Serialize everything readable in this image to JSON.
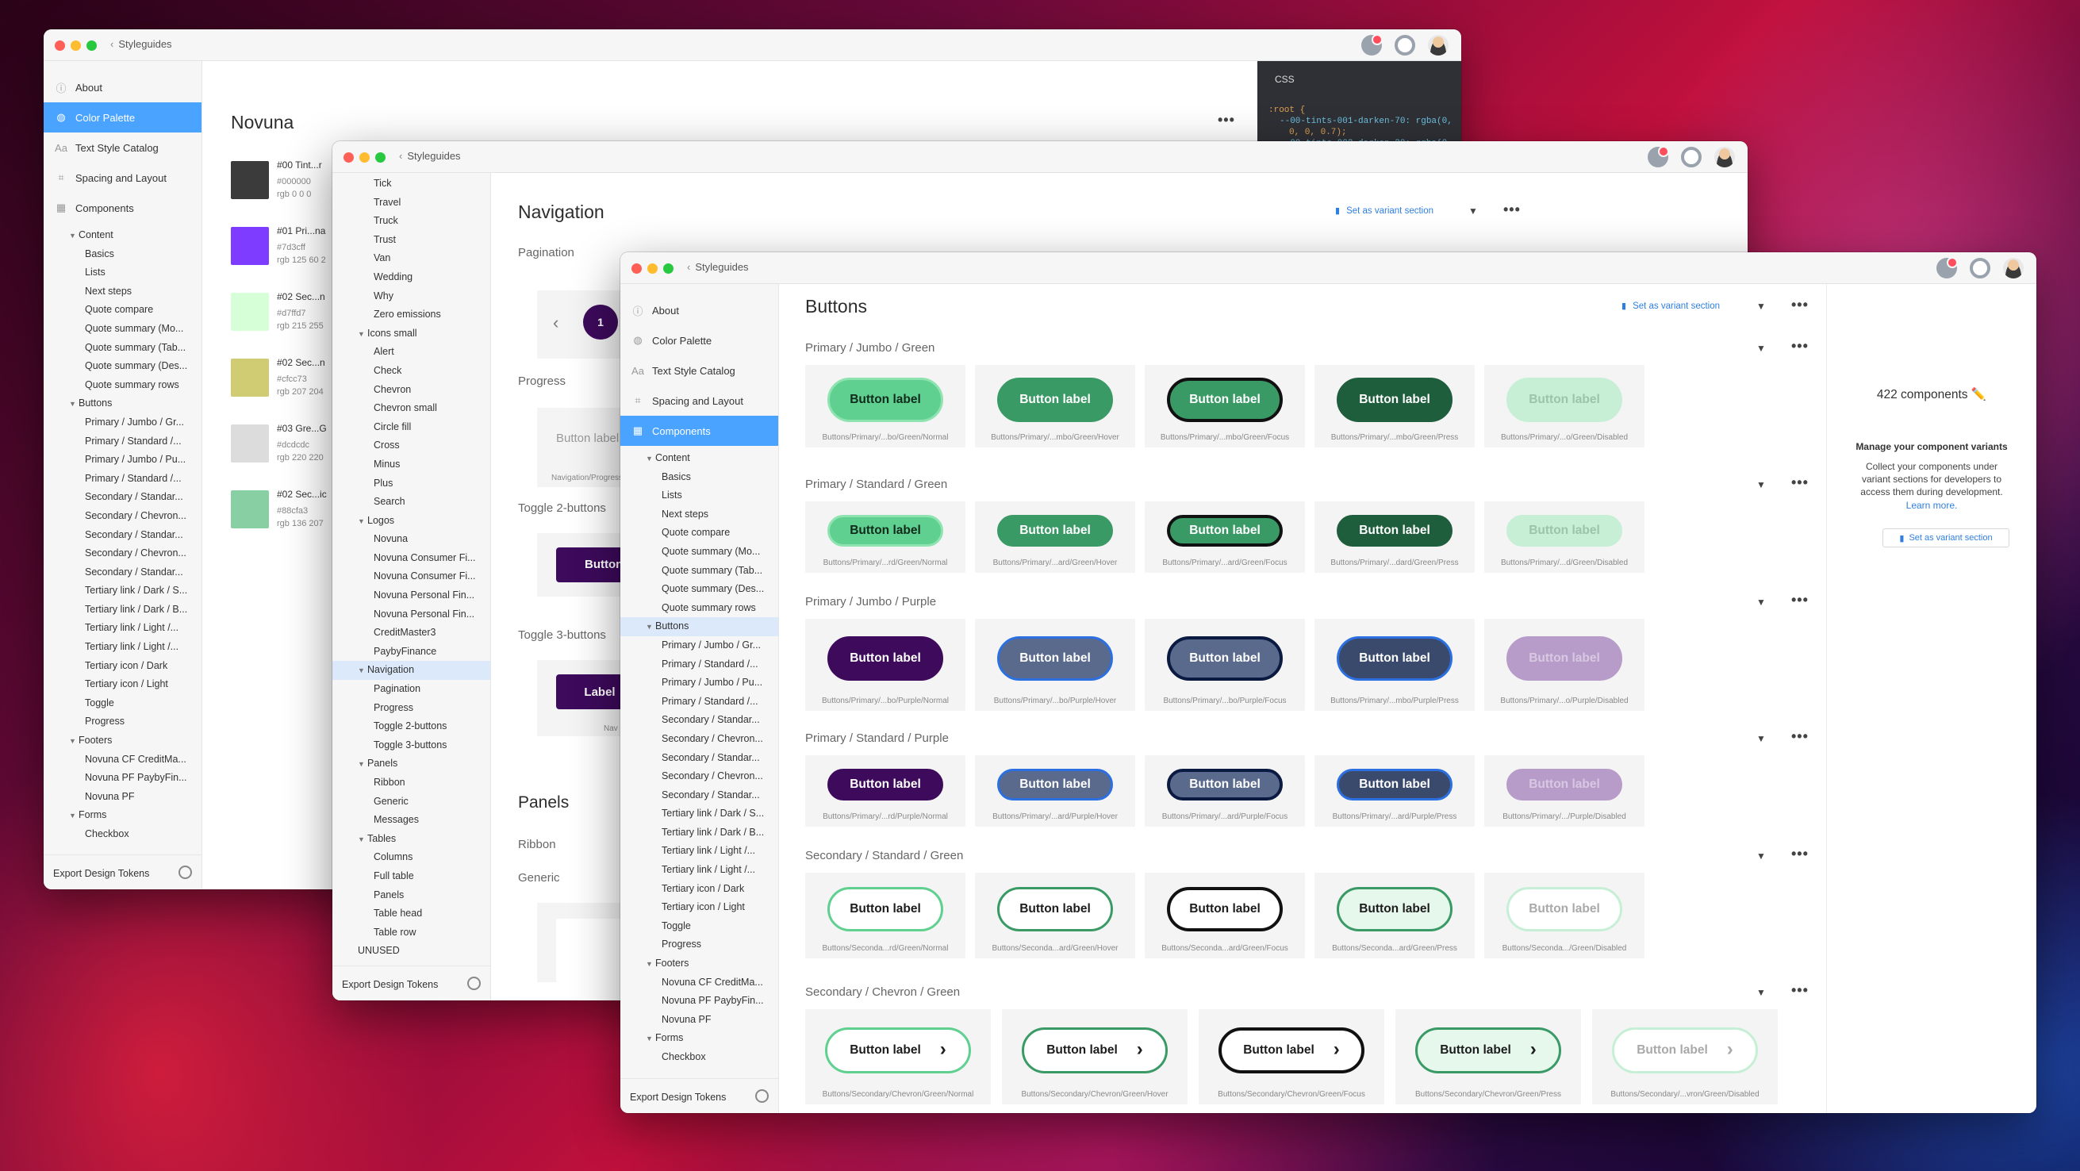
{
  "app_crumb": "Styleguides",
  "win1": {
    "title": "Novuna",
    "nav": [
      "About",
      "Color Palette",
      "Text Style Catalog",
      "Spacing and Layout",
      "Components"
    ],
    "tree": [
      {
        "t": "Content",
        "lvl": 1,
        "caret": true
      },
      {
        "t": "Basics",
        "lvl": 2
      },
      {
        "t": "Lists",
        "lvl": 2
      },
      {
        "t": "Next steps",
        "lvl": 2
      },
      {
        "t": "Quote compare",
        "lvl": 2
      },
      {
        "t": "Quote summary (Mo...",
        "lvl": 2
      },
      {
        "t": "Quote summary (Tab...",
        "lvl": 2
      },
      {
        "t": "Quote summary (Des...",
        "lvl": 2
      },
      {
        "t": "Quote summary rows",
        "lvl": 2
      },
      {
        "t": "Buttons",
        "lvl": 1,
        "caret": true
      },
      {
        "t": "Primary / Jumbo / Gr...",
        "lvl": 2
      },
      {
        "t": "Primary / Standard /...",
        "lvl": 2
      },
      {
        "t": "Primary / Jumbo / Pu...",
        "lvl": 2
      },
      {
        "t": "Primary / Standard /...",
        "lvl": 2
      },
      {
        "t": "Secondary / Standar...",
        "lvl": 2
      },
      {
        "t": "Secondary / Chevron...",
        "lvl": 2
      },
      {
        "t": "Secondary / Standar...",
        "lvl": 2
      },
      {
        "t": "Secondary / Chevron...",
        "lvl": 2
      },
      {
        "t": "Secondary / Standar...",
        "lvl": 2
      },
      {
        "t": "Tertiary link / Dark / S...",
        "lvl": 2
      },
      {
        "t": "Tertiary link / Dark / B...",
        "lvl": 2
      },
      {
        "t": "Tertiary link / Light /...",
        "lvl": 2
      },
      {
        "t": "Tertiary link / Light /...",
        "lvl": 2
      },
      {
        "t": "Tertiary icon / Dark",
        "lvl": 2
      },
      {
        "t": "Tertiary icon / Light",
        "lvl": 2
      },
      {
        "t": "Toggle",
        "lvl": 2
      },
      {
        "t": "Progress",
        "lvl": 2
      },
      {
        "t": "Footers",
        "lvl": 1,
        "caret": true
      },
      {
        "t": "Novuna CF CreditMa...",
        "lvl": 2
      },
      {
        "t": "Novuna PF PaybyFin...",
        "lvl": 2
      },
      {
        "t": "Novuna PF",
        "lvl": 2
      },
      {
        "t": "Forms",
        "lvl": 1,
        "caret": true
      },
      {
        "t": "Checkbox",
        "lvl": 2
      }
    ],
    "footer": "Export Design Tokens",
    "swatches": [
      {
        "name": "#00 Tint...r",
        "hex": "#000000",
        "rgb": "rgb 0 0 0",
        "color": "#3b3b3b"
      },
      {
        "name": "#01 Pri...na",
        "hex": "#7d3cff",
        "rgb": "rgb 125 60 2",
        "color": "#7d3cff"
      },
      {
        "name": "#02 Sec...n",
        "hex": "#d7ffd7",
        "rgb": "rgb 215 255",
        "color": "#d7ffd7"
      },
      {
        "name": "#02 Sec...n",
        "hex": "#cfcc73",
        "rgb": "rgb 207 204",
        "color": "#cfcc73"
      },
      {
        "name": "#03 Gre...G",
        "hex": "#dcdcdc",
        "rgb": "rgb 220 220",
        "color": "#dcdcdc"
      },
      {
        "name": "#02 Sec...ic",
        "hex": "#88cfa3",
        "rgb": "rgb 136 207",
        "color": "#88cfa3"
      }
    ],
    "css": {
      "tab": "CSS",
      "l1": ":root {",
      "l2": "--00-tints-001-darken-70: rgba(0,",
      "l3": "0, 0, 0.7);",
      "l4": "--00-tints-002-darken-30: rgba(0,"
    }
  },
  "win2": {
    "title": "Navigation",
    "set_variant": "Set as variant section",
    "tree": [
      {
        "t": "Tick",
        "lvl": 2
      },
      {
        "t": "Travel",
        "lvl": 2
      },
      {
        "t": "Truck",
        "lvl": 2
      },
      {
        "t": "Trust",
        "lvl": 2
      },
      {
        "t": "Van",
        "lvl": 2
      },
      {
        "t": "Wedding",
        "lvl": 2
      },
      {
        "t": "Why",
        "lvl": 2
      },
      {
        "t": "Zero emissions",
        "lvl": 2
      },
      {
        "t": "Icons small",
        "lvl": 1,
        "caret": true
      },
      {
        "t": "Alert",
        "lvl": 2
      },
      {
        "t": "Check",
        "lvl": 2
      },
      {
        "t": "Chevron",
        "lvl": 2
      },
      {
        "t": "Chevron small",
        "lvl": 2
      },
      {
        "t": "Circle fill",
        "lvl": 2
      },
      {
        "t": "Cross",
        "lvl": 2
      },
      {
        "t": "Minus",
        "lvl": 2
      },
      {
        "t": "Plus",
        "lvl": 2
      },
      {
        "t": "Search",
        "lvl": 2
      },
      {
        "t": "Logos",
        "lvl": 1,
        "caret": true
      },
      {
        "t": "Novuna",
        "lvl": 2
      },
      {
        "t": "Novuna Consumer Fi...",
        "lvl": 2
      },
      {
        "t": "Novuna Consumer Fi...",
        "lvl": 2
      },
      {
        "t": "Novuna Personal Fin...",
        "lvl": 2
      },
      {
        "t": "Novuna Personal Fin...",
        "lvl": 2
      },
      {
        "t": "CreditMaster3",
        "lvl": 2
      },
      {
        "t": "PaybyFinance",
        "lvl": 2
      },
      {
        "t": "Navigation",
        "lvl": 1,
        "caret": true,
        "sel": true
      },
      {
        "t": "Pagination",
        "lvl": 2
      },
      {
        "t": "Progress",
        "lvl": 2
      },
      {
        "t": "Toggle 2-buttons",
        "lvl": 2
      },
      {
        "t": "Toggle 3-buttons",
        "lvl": 2
      },
      {
        "t": "Panels",
        "lvl": 1,
        "caret": true
      },
      {
        "t": "Ribbon",
        "lvl": 2
      },
      {
        "t": "Generic",
        "lvl": 2
      },
      {
        "t": "Messages",
        "lvl": 2
      },
      {
        "t": "Tables",
        "lvl": 1,
        "caret": true
      },
      {
        "t": "Columns",
        "lvl": 2
      },
      {
        "t": "Full table",
        "lvl": 2
      },
      {
        "t": "Panels",
        "lvl": 2
      },
      {
        "t": "Table head",
        "lvl": 2
      },
      {
        "t": "Table row",
        "lvl": 2
      },
      {
        "t": "UNUSED",
        "lvl": 1
      }
    ],
    "footer": "Export Design Tokens",
    "pagination_label": "Pagination",
    "page_current": "1",
    "page_cap": "Na",
    "progress_label": "Progress",
    "progress_btn": "Button label",
    "progress_cap": "Navigation/Progress/",
    "toggle2_label": "Toggle 2-buttons",
    "toggle2_btn": "Button l",
    "toggle3_label": "Toggle 3-buttons",
    "toggle3_btn": "Label",
    "toggle3_cap": "Nav",
    "panels": "Panels",
    "ribbon": "Ribbon",
    "generic": "Generic"
  },
  "win3": {
    "title": "Buttons",
    "set_variant": "Set as variant section",
    "nav": [
      "About",
      "Color Palette",
      "Text Style Catalog",
      "Spacing and Layout",
      "Components"
    ],
    "tree": [
      {
        "t": "Content",
        "lvl": 1,
        "caret": true
      },
      {
        "t": "Basics",
        "lvl": 2
      },
      {
        "t": "Lists",
        "lvl": 2
      },
      {
        "t": "Next steps",
        "lvl": 2
      },
      {
        "t": "Quote compare",
        "lvl": 2
      },
      {
        "t": "Quote summary (Mo...",
        "lvl": 2
      },
      {
        "t": "Quote summary (Tab...",
        "lvl": 2
      },
      {
        "t": "Quote summary (Des...",
        "lvl": 2
      },
      {
        "t": "Quote summary rows",
        "lvl": 2
      },
      {
        "t": "Buttons",
        "lvl": 1,
        "caret": true,
        "sel": true
      },
      {
        "t": "Primary / Jumbo / Gr...",
        "lvl": 2
      },
      {
        "t": "Primary / Standard /...",
        "lvl": 2
      },
      {
        "t": "Primary / Jumbo / Pu...",
        "lvl": 2
      },
      {
        "t": "Primary / Standard /...",
        "lvl": 2
      },
      {
        "t": "Secondary / Standar...",
        "lvl": 2
      },
      {
        "t": "Secondary / Chevron...",
        "lvl": 2
      },
      {
        "t": "Secondary / Standar...",
        "lvl": 2
      },
      {
        "t": "Secondary / Chevron...",
        "lvl": 2
      },
      {
        "t": "Secondary / Standar...",
        "lvl": 2
      },
      {
        "t": "Tertiary link / Dark / S...",
        "lvl": 2
      },
      {
        "t": "Tertiary link / Dark / B...",
        "lvl": 2
      },
      {
        "t": "Tertiary link / Light /...",
        "lvl": 2
      },
      {
        "t": "Tertiary link / Light /...",
        "lvl": 2
      },
      {
        "t": "Tertiary icon / Dark",
        "lvl": 2
      },
      {
        "t": "Tertiary icon / Light",
        "lvl": 2
      },
      {
        "t": "Toggle",
        "lvl": 2
      },
      {
        "t": "Progress",
        "lvl": 2
      },
      {
        "t": "Footers",
        "lvl": 1,
        "caret": true
      },
      {
        "t": "Novuna CF CreditMa...",
        "lvl": 2
      },
      {
        "t": "Novuna PF PaybyFin...",
        "lvl": 2
      },
      {
        "t": "Novuna PF",
        "lvl": 2
      },
      {
        "t": "Forms",
        "lvl": 1,
        "caret": true
      },
      {
        "t": "Checkbox",
        "lvl": 2
      }
    ],
    "footer": "Export Design Tokens",
    "components_count": "422 components ✏️",
    "manage_title": "Manage your component variants",
    "manage_text": "Collect your components under variant sections for developers to access them during development.",
    "learn_more": "Learn more.",
    "set_variant_btn": "Set as variant section",
    "sections": [
      {
        "title": "Primary / Jumbo / Green",
        "kind": "jumbo",
        "chev": false,
        "label": "Button label",
        "caps": [
          "Buttons/Primary/...bo/Green/Normal",
          "Buttons/Primary/...mbo/Green/Hover",
          "Buttons/Primary/...mbo/Green/Focus",
          "Buttons/Primary/...mbo/Green/Press",
          "Buttons/Primary/...o/Green/Disabled"
        ],
        "styles": [
          {
            "bg": "#5fd08f",
            "fg": "#102a1c",
            "bd": "#8ee3b0"
          },
          {
            "bg": "#3a9a66",
            "fg": "#ffffff",
            "bd": "#3a9a66"
          },
          {
            "bg": "#3a9a66",
            "fg": "#ffffff",
            "bd": "#111111"
          },
          {
            "bg": "#1f5e3c",
            "fg": "#ffffff",
            "bd": "#1f5e3c"
          },
          {
            "bg": "#c6efd6",
            "fg": "#9bc4aa",
            "bd": "#c6efd6"
          }
        ]
      },
      {
        "title": "Primary / Standard / Green",
        "kind": "standard",
        "chev": false,
        "label": "Button label",
        "caps": [
          "Buttons/Primary/...rd/Green/Normal",
          "Buttons/Primary/...ard/Green/Hover",
          "Buttons/Primary/...ard/Green/Focus",
          "Buttons/Primary/...dard/Green/Press",
          "Buttons/Primary/...d/Green/Disabled"
        ],
        "styles": [
          {
            "bg": "#5fd08f",
            "fg": "#102a1c",
            "bd": "#8ee3b0"
          },
          {
            "bg": "#3a9a66",
            "fg": "#ffffff",
            "bd": "#3a9a66"
          },
          {
            "bg": "#3a9a66",
            "fg": "#ffffff",
            "bd": "#111111"
          },
          {
            "bg": "#1f5e3c",
            "fg": "#ffffff",
            "bd": "#1f5e3c"
          },
          {
            "bg": "#c6efd6",
            "fg": "#9bc4aa",
            "bd": "#c6efd6"
          }
        ]
      },
      {
        "title": "Primary / Jumbo / Purple",
        "kind": "jumbo",
        "chev": false,
        "label": "Button label",
        "caps": [
          "Buttons/Primary/...bo/Purple/Normal",
          "Buttons/Primary/...bo/Purple/Hover",
          "Buttons/Primary/...bo/Purple/Focus",
          "Buttons/Primary/...mbo/Purple/Press",
          "Buttons/Primary/...o/Purple/Disabled"
        ],
        "styles": [
          {
            "bg": "#3d0a5c",
            "fg": "#ffffff",
            "bd": "#3d0a5c"
          },
          {
            "bg": "#5a6a8c",
            "fg": "#ffffff",
            "bd": "#2b6fe0"
          },
          {
            "bg": "#5a6a8c",
            "fg": "#ffffff",
            "bd": "#0b1a40"
          },
          {
            "bg": "#3a4a6c",
            "fg": "#ffffff",
            "bd": "#2b6fe0"
          },
          {
            "bg": "#b79cc9",
            "fg": "#d8c8e2",
            "bd": "#b79cc9"
          }
        ]
      },
      {
        "title": "Primary / Standard / Purple",
        "kind": "standard",
        "chev": false,
        "label": "Button label",
        "caps": [
          "Buttons/Primary/...rd/Purple/Normal",
          "Buttons/Primary/...ard/Purple/Hover",
          "Buttons/Primary/...ard/Purple/Focus",
          "Buttons/Primary/...ard/Purple/Press",
          "Buttons/Primary/.../Purple/Disabled"
        ],
        "styles": [
          {
            "bg": "#3d0a5c",
            "fg": "#ffffff",
            "bd": "#3d0a5c"
          },
          {
            "bg": "#5a6a8c",
            "fg": "#ffffff",
            "bd": "#2b6fe0"
          },
          {
            "bg": "#5a6a8c",
            "fg": "#ffffff",
            "bd": "#0b1a40"
          },
          {
            "bg": "#3a4a6c",
            "fg": "#ffffff",
            "bd": "#2b6fe0"
          },
          {
            "bg": "#b79cc9",
            "fg": "#d8c8e2",
            "bd": "#b79cc9"
          }
        ]
      },
      {
        "title": "Secondary / Standard / Green",
        "kind": "secondary",
        "chev": false,
        "label": "Button label",
        "caps": [
          "Buttons/Seconda...rd/Green/Normal",
          "Buttons/Seconda...ard/Green/Hover",
          "Buttons/Seconda...ard/Green/Focus",
          "Buttons/Seconda...ard/Green/Press",
          "Buttons/Seconda.../Green/Disabled"
        ],
        "styles": [
          {
            "bg": "#ffffff",
            "fg": "#1c1c1c",
            "bd": "#5fd08f"
          },
          {
            "bg": "#ffffff",
            "fg": "#1c1c1c",
            "bd": "#3a9a66"
          },
          {
            "bg": "#ffffff",
            "fg": "#1c1c1c",
            "bd": "#111111"
          },
          {
            "bg": "#e6f7ec",
            "fg": "#1c1c1c",
            "bd": "#3a9a66"
          },
          {
            "bg": "#ffffff",
            "fg": "#a9a9a9",
            "bd": "#c6efd6"
          }
        ]
      },
      {
        "title": "Secondary / Chevron / Green",
        "kind": "secondary",
        "chev": true,
        "label": "Button label",
        "caps": [
          "Buttons/Secondary/Chevron/Green/Normal",
          "Buttons/Secondary/Chevron/Green/Hover",
          "Buttons/Secondary/Chevron/Green/Focus",
          "Buttons/Secondary/Chevron/Green/Press",
          "Buttons/Secondary/...vron/Green/Disabled"
        ],
        "styles": [
          {
            "bg": "#ffffff",
            "fg": "#1c1c1c",
            "bd": "#5fd08f"
          },
          {
            "bg": "#ffffff",
            "fg": "#1c1c1c",
            "bd": "#3a9a66"
          },
          {
            "bg": "#ffffff",
            "fg": "#1c1c1c",
            "bd": "#111111"
          },
          {
            "bg": "#e6f7ec",
            "fg": "#1c1c1c",
            "bd": "#3a9a66"
          },
          {
            "bg": "#ffffff",
            "fg": "#a9a9a9",
            "bd": "#c6efd6"
          }
        ]
      }
    ]
  }
}
